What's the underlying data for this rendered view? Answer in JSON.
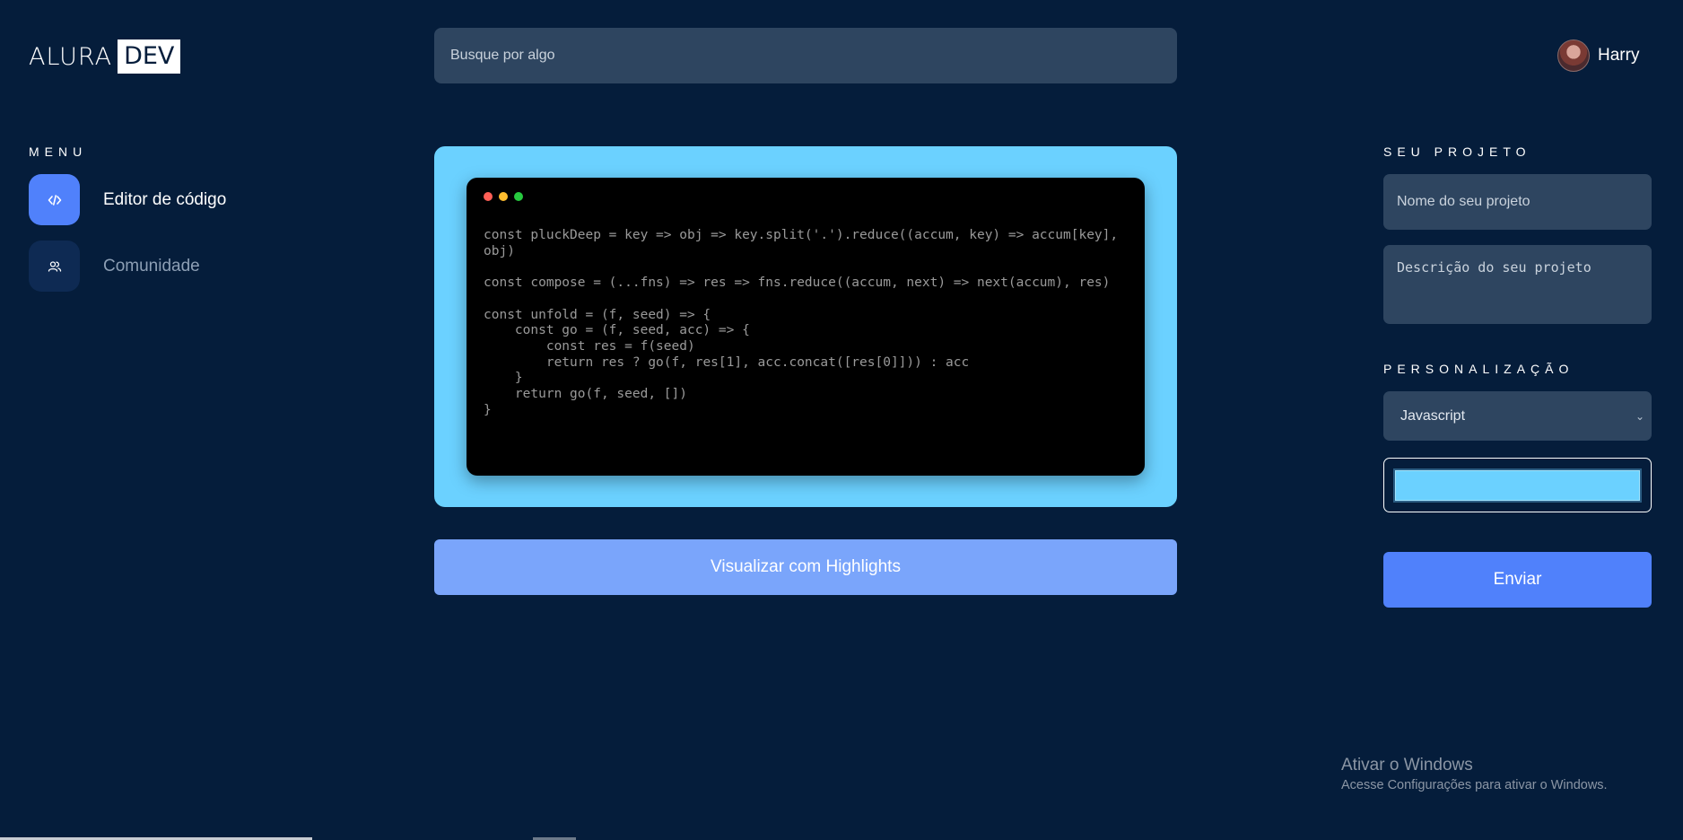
{
  "header": {
    "logo_text": "ALURA",
    "logo_badge": "DEV",
    "search_placeholder": "Busque por algo",
    "user_name": "Harry"
  },
  "menu": {
    "title": "MENU",
    "items": [
      {
        "label": "Editor de código",
        "icon": "code-icon",
        "active": true
      },
      {
        "label": "Comunidade",
        "icon": "people-icon",
        "active": false
      }
    ]
  },
  "editor": {
    "code": "const pluckDeep = key => obj => key.split('.').reduce((accum, key) => accum[key], obj)\n\nconst compose = (...fns) => res => fns.reduce((accum, next) => next(accum), res)\n\nconst unfold = (f, seed) => {\n    const go = (f, seed, acc) => {\n        const res = f(seed)\n        return res ? go(f, res[1], acc.concat([res[0]])) : acc\n    }\n    return go(f, seed, [])\n}",
    "frame_color": "#6bd1ff",
    "highlight_button": "Visualizar com Highlights"
  },
  "project": {
    "title": "SEU PROJETO",
    "name_placeholder": "Nome do seu projeto",
    "description_placeholder": "Descrição do seu projeto"
  },
  "customization": {
    "title": "PERSONALIZAÇÃO",
    "language_selected": "Javascript",
    "color_value": "#6bd1ff",
    "send_button": "Enviar"
  },
  "watermark": {
    "title": "Ativar o Windows",
    "subtitle": "Acesse Configurações para ativar o Windows."
  },
  "colors": {
    "background": "#051d3b",
    "accent": "#5081fb",
    "accent_light": "#7aa5fb",
    "field": "#2e4560"
  }
}
